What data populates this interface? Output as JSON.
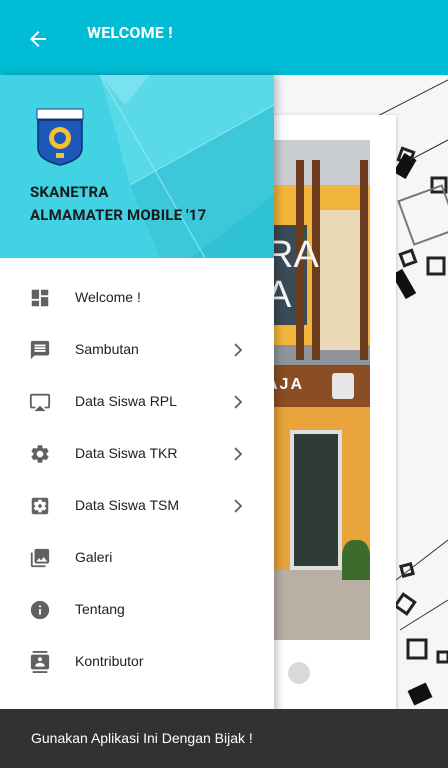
{
  "appbar": {
    "title": "WELCOME !",
    "back_icon": "arrow-back-icon",
    "color": "#00bcd4"
  },
  "drawer": {
    "header": {
      "line1": "SKANETRA",
      "line2": "ALMAMATER MOBILE '17",
      "color": "#41d2e3",
      "logo_icon": "school-emblem-logo"
    },
    "items": [
      {
        "label": "Welcome !",
        "icon": "dashboard-icon",
        "has_chevron": false
      },
      {
        "label": "Sambutan",
        "icon": "message-icon",
        "has_chevron": true
      },
      {
        "label": "Data Siswa RPL",
        "icon": "airplay-icon",
        "has_chevron": true
      },
      {
        "label": "Data Siswa TKR",
        "icon": "settings-icon",
        "has_chevron": true
      },
      {
        "label": "Data Siswa TSM",
        "icon": "settings-applications-icon",
        "has_chevron": true
      },
      {
        "label": "Galeri",
        "icon": "photo-library-icon",
        "has_chevron": false
      },
      {
        "label": "Tentang",
        "icon": "info-icon",
        "has_chevron": false
      },
      {
        "label": "Kontributor",
        "icon": "contacts-icon",
        "has_chevron": false
      }
    ]
  },
  "snackbar": {
    "message": "Gunakan Aplikasi Ini Dengan Bijak !"
  }
}
